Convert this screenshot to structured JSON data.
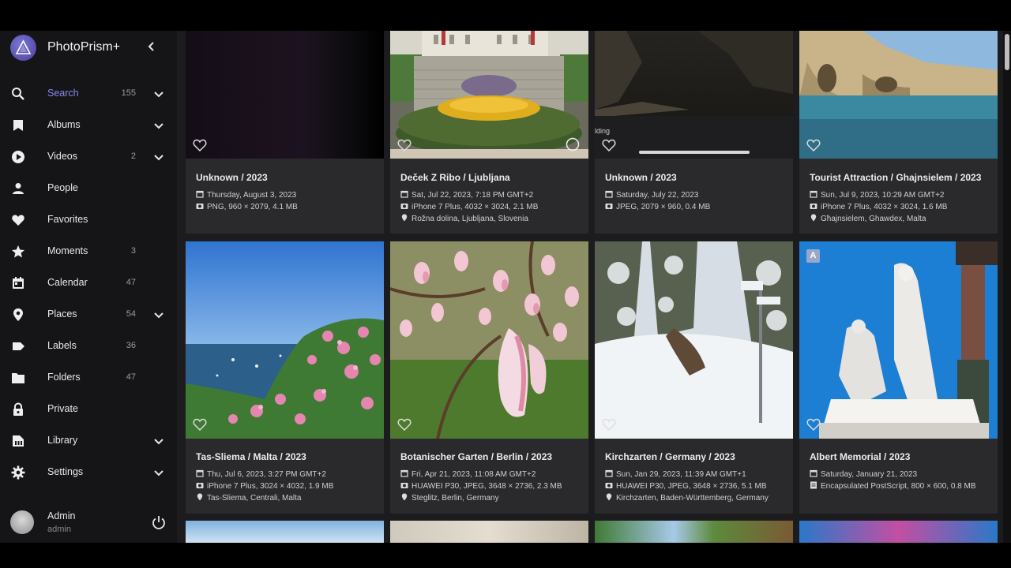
{
  "app": {
    "name": "PhotoPrism+"
  },
  "sidebar": {
    "items": [
      {
        "label": "Search",
        "count": "155"
      },
      {
        "label": "Albums",
        "count": ""
      },
      {
        "label": "Videos",
        "count": "2"
      },
      {
        "label": "People",
        "count": ""
      },
      {
        "label": "Favorites",
        "count": ""
      },
      {
        "label": "Moments",
        "count": "3"
      },
      {
        "label": "Calendar",
        "count": "47"
      },
      {
        "label": "Places",
        "count": "54"
      },
      {
        "label": "Labels",
        "count": "36"
      },
      {
        "label": "Folders",
        "count": "47"
      },
      {
        "label": "Private",
        "count": ""
      },
      {
        "label": "Library",
        "count": ""
      },
      {
        "label": "Settings",
        "count": ""
      }
    ],
    "icons": [
      "search-icon",
      "album-icon",
      "play-icon",
      "person-icon",
      "heart-icon",
      "star-icon",
      "calendar-icon",
      "place-icon",
      "label-icon",
      "folder-icon",
      "lock-icon",
      "library-icon",
      "gear-icon"
    ],
    "active_color": "#8e85f0"
  },
  "user": {
    "name": "Admin",
    "login": "admin"
  },
  "photos": [
    {
      "title": "Unknown / 2023",
      "date": "Thursday, August 3, 2023",
      "camera": "PNG, 960 × 2079, 4.1 MB",
      "place": ""
    },
    {
      "title": "Deček Z Ribo / Ljubljana",
      "date": "Sat, Jul 22, 2023, 7:18 PM GMT+2",
      "camera": "iPhone 7 Plus, 4032 × 3024, 2.1 MB",
      "place": "Rožna dolina, Ljubljana, Slovenia"
    },
    {
      "title": "Unknown / 2023",
      "date": "Saturday, July 22, 2023",
      "camera": "JPEG, 2079 × 960, 0.4 MB",
      "place": "",
      "overlay_text": "lding"
    },
    {
      "title": "Tourist Attraction / Ghajnsielem / 2023",
      "date": "Sun, Jul 9, 2023, 10:29 AM GMT+2",
      "camera": "iPhone 7 Plus, 4032 × 3024, 1.6 MB",
      "place": "Għajnsielem, Ghawdex, Malta"
    },
    {
      "title": "Tas-Sliema / Malta / 2023",
      "date": "Thu, Jul 6, 2023, 3:27 PM GMT+2",
      "camera": "iPhone 7 Plus, 3024 × 4032, 1.9 MB",
      "place": "Tas-Sliema, Centrali, Malta"
    },
    {
      "title": "Botanischer Garten / Berlin / 2023",
      "date": "Fri, Apr 21, 2023, 11:08 AM GMT+2",
      "camera": "HUAWEI P30, JPEG, 3648 × 2736, 2.3 MB",
      "place": "Steglitz, Berlin, Germany"
    },
    {
      "title": "Kirchzarten / Germany / 2023",
      "date": "Sun, Jan 29, 2023, 11:39 AM GMT+1",
      "camera": "HUAWEI P30, JPEG, 3648 × 2736, 5.1 MB",
      "place": "Kirchzarten, Baden-Württemberg, Germany"
    },
    {
      "title": "Albert Memorial / 2023",
      "date": "Saturday, January 21, 2023",
      "camera": "Encapsulated PostScript, 800 × 600, 0.8 MB",
      "place": "",
      "badge": "A"
    }
  ]
}
